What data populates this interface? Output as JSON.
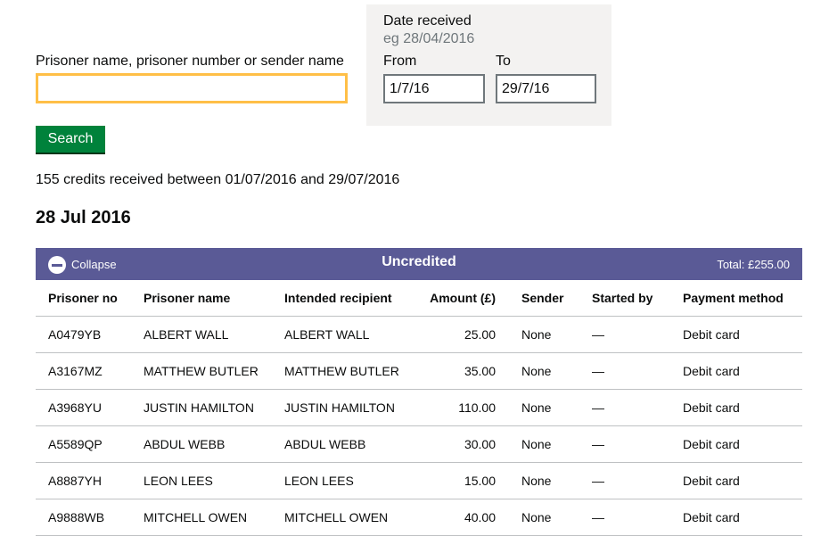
{
  "search": {
    "label": "Prisoner name, prisoner number or sender name",
    "value": "",
    "button_label": "Search"
  },
  "date_filter": {
    "title": "Date received",
    "hint": "eg 28/04/2016",
    "from_label": "From",
    "from_value": "1/7/16",
    "to_label": "To",
    "to_value": "29/7/16"
  },
  "results_summary": "155 credits received between 01/07/2016 and 29/07/2016",
  "date_heading": "28 Jul 2016",
  "group": {
    "collapse_label": "Collapse",
    "status": "Uncredited",
    "total": "Total: £255.00"
  },
  "table": {
    "headers": [
      "Prisoner no",
      "Prisoner name",
      "Intended recipient",
      "Amount (£)",
      "Sender",
      "Started by",
      "Payment method"
    ],
    "rows": [
      {
        "prisoner_no": "A0479YB",
        "prisoner_name": "ALBERT WALL",
        "recipient": "ALBERT WALL",
        "amount": "25.00",
        "sender": "None",
        "started_by": "—",
        "method": "Debit card"
      },
      {
        "prisoner_no": "A3167MZ",
        "prisoner_name": "MATTHEW BUTLER",
        "recipient": "MATTHEW BUTLER",
        "amount": "35.00",
        "sender": "None",
        "started_by": "—",
        "method": "Debit card"
      },
      {
        "prisoner_no": "A3968YU",
        "prisoner_name": "JUSTIN HAMILTON",
        "recipient": "JUSTIN HAMILTON",
        "amount": "110.00",
        "sender": "None",
        "started_by": "—",
        "method": "Debit card"
      },
      {
        "prisoner_no": "A5589QP",
        "prisoner_name": "ABDUL WEBB",
        "recipient": "ABDUL WEBB",
        "amount": "30.00",
        "sender": "None",
        "started_by": "—",
        "method": "Debit card"
      },
      {
        "prisoner_no": "A8887YH",
        "prisoner_name": "LEON LEES",
        "recipient": "LEON LEES",
        "amount": "15.00",
        "sender": "None",
        "started_by": "—",
        "method": "Debit card"
      },
      {
        "prisoner_no": "A9888WB",
        "prisoner_name": "MITCHELL OWEN",
        "recipient": "MITCHELL OWEN",
        "amount": "40.00",
        "sender": "None",
        "started_by": "—",
        "method": "Debit card"
      }
    ]
  },
  "colors": {
    "accent_bar": "#5a5a96",
    "button": "#00823b",
    "focus": "#ffbf47"
  }
}
